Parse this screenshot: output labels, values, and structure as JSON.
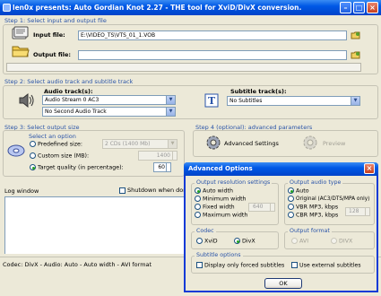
{
  "window": {
    "title": "len0x presents: Auto Gordian Knot 2.27 - THE tool for XviD/DivX conversion."
  },
  "step1": {
    "heading": "Step 1: Select input and output file",
    "input_label": "Input file:",
    "input_value": "E:\\VIDEO_TS\\VTS_01_1.VOB",
    "output_label": "Output file:",
    "output_value": ""
  },
  "step2": {
    "heading": "Step 2: Select audio track and subtitle track",
    "audio_label": "Audio track(s):",
    "audio_track1": "Audio Stream 0 AC3",
    "audio_track2": "No Second Audio Track",
    "subtitle_label": "Subtitle track(s):",
    "subtitle_value": "No Subtitles"
  },
  "step3": {
    "heading": "Step 3: Select output size",
    "option_title": "Select an option",
    "predefined_label": "Predefined size:",
    "predefined_value": "2 CDs (1400 Mb)",
    "custom_label": "Custom size (MB):",
    "custom_value": "1400",
    "target_label": "Target quality (in percentage):",
    "target_value": "60"
  },
  "step4": {
    "heading": "Step 4 (optional): advanced parameters",
    "advanced_label": "Advanced Settings",
    "preview_label": "Preview"
  },
  "log": {
    "title": "Log window",
    "shutdown_label": "Shutdown when done"
  },
  "status": {
    "text": "Codec: DivX - Audio: Auto - Auto width - AVI format"
  },
  "dialog": {
    "title": "Advanced Options",
    "res_title": "Output resolution settings",
    "res_auto": "Auto width",
    "res_min": "Minimum width",
    "res_fixed": "Fixed width",
    "res_fixed_value": "640",
    "res_max": "Maximum width",
    "audio_title": "Output audio type",
    "audio_auto": "Auto",
    "audio_original": "Original (AC3/DTS/MPA only)",
    "audio_vbr": "VBR MP3, kbps",
    "audio_cbr": "CBR MP3, kbps",
    "audio_kbps_value": "128",
    "codec_title": "Codec",
    "codec_xvid": "XviD",
    "codec_divx": "DivX",
    "format_title": "Output format",
    "format_avi": "AVI",
    "format_divx": "DIVX",
    "subs_title": "Subtitle options",
    "subs_forced": "Display only forced subtitles",
    "subs_external": "Use external subtitles",
    "ok_label": "OK"
  },
  "colors": {
    "titlebar": "#0058e6",
    "face": "#ece9d8",
    "step_text": "#2a54a8",
    "close_button": "#c6401e"
  }
}
